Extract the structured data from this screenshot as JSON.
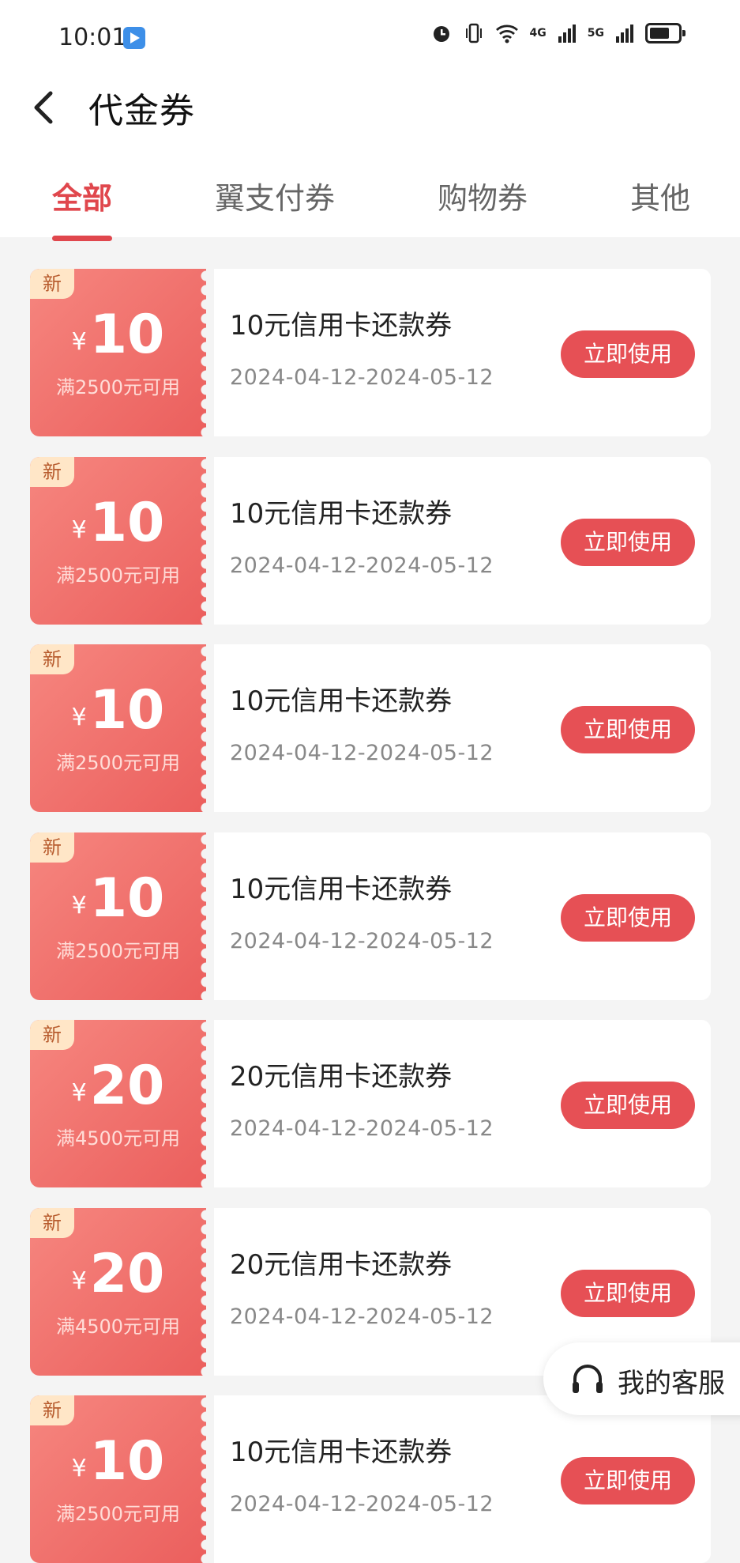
{
  "status": {
    "time": "10:01",
    "net1": "4G",
    "net2": "5G"
  },
  "header": {
    "title": "代金券"
  },
  "tabs": [
    {
      "label": "全部",
      "active": true
    },
    {
      "label": "翼支付券"
    },
    {
      "label": "购物券"
    },
    {
      "label": "其他"
    }
  ],
  "coupons": [
    {
      "badge": "新",
      "yen": "¥",
      "amount": "10",
      "condition": "满2500元可用",
      "title": "10元信用卡还款券",
      "date": "2024-04-12-2024-05-12",
      "button": "立即使用"
    },
    {
      "badge": "新",
      "yen": "¥",
      "amount": "10",
      "condition": "满2500元可用",
      "title": "10元信用卡还款券",
      "date": "2024-04-12-2024-05-12",
      "button": "立即使用"
    },
    {
      "badge": "新",
      "yen": "¥",
      "amount": "10",
      "condition": "满2500元可用",
      "title": "10元信用卡还款券",
      "date": "2024-04-12-2024-05-12",
      "button": "立即使用"
    },
    {
      "badge": "新",
      "yen": "¥",
      "amount": "10",
      "condition": "满2500元可用",
      "title": "10元信用卡还款券",
      "date": "2024-04-12-2024-05-12",
      "button": "立即使用"
    },
    {
      "badge": "新",
      "yen": "¥",
      "amount": "20",
      "condition": "满4500元可用",
      "title": "20元信用卡还款券",
      "date": "2024-04-12-2024-05-12",
      "button": "立即使用"
    },
    {
      "badge": "新",
      "yen": "¥",
      "amount": "20",
      "condition": "满4500元可用",
      "title": "20元信用卡还款券",
      "date": "2024-04-12-2024-05-12",
      "button": "立即使用"
    },
    {
      "badge": "新",
      "yen": "¥",
      "amount": "10",
      "condition": "满2500元可用",
      "title": "10元信用卡还款券",
      "date": "2024-04-12-2024-05-12",
      "button": "立即使用"
    }
  ],
  "service": {
    "label": "我的客服"
  },
  "colors": {
    "accent": "#e0474d",
    "coupon": "#eb5f5d",
    "badge_bg": "#ffe6c7"
  }
}
